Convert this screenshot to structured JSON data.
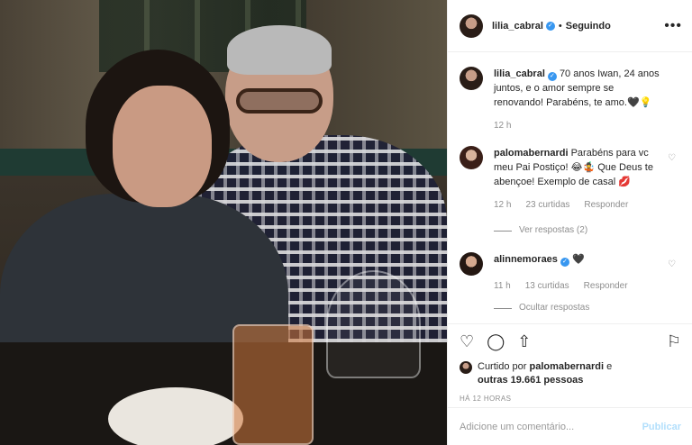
{
  "header": {
    "username": "lilia_cabral",
    "separator": "•",
    "follow_status": "Seguindo",
    "more_icon": "ellipsis-icon"
  },
  "caption": {
    "username": "lilia_cabral",
    "text": "70 anos Iwan, 24 anos juntos, e o amor sempre se renovando! Parabéns, te amo.🖤💡",
    "time": "12 h"
  },
  "comments": [
    {
      "username": "palomabernardi",
      "text": "Parabéns para vc meu Pai Postiço! 😂🤹 Que Deus te abençoe! Exemplo de casal 💋",
      "time": "12 h",
      "likes": "23 curtidas",
      "reply": "Responder",
      "replies_toggle": "Ver respostas (2)"
    },
    {
      "username": "alinnemoraes",
      "text": "🖤",
      "time": "11 h",
      "likes": "13 curtidas",
      "reply": "Responder",
      "replies_toggle": "Ocultar respostas"
    }
  ],
  "actions": {
    "like_icon": "heart-icon",
    "comment_icon": "comment-icon",
    "share_icon": "share-icon",
    "save_icon": "bookmark-icon"
  },
  "likes": {
    "prefix": "Curtido por",
    "user": "palomabernardi",
    "middle": "e",
    "others": "outras 19.661 pessoas"
  },
  "timestamp": "HÁ 12 HORAS",
  "add_comment": {
    "placeholder": "Adicione um comentário...",
    "publish": "Publicar"
  }
}
